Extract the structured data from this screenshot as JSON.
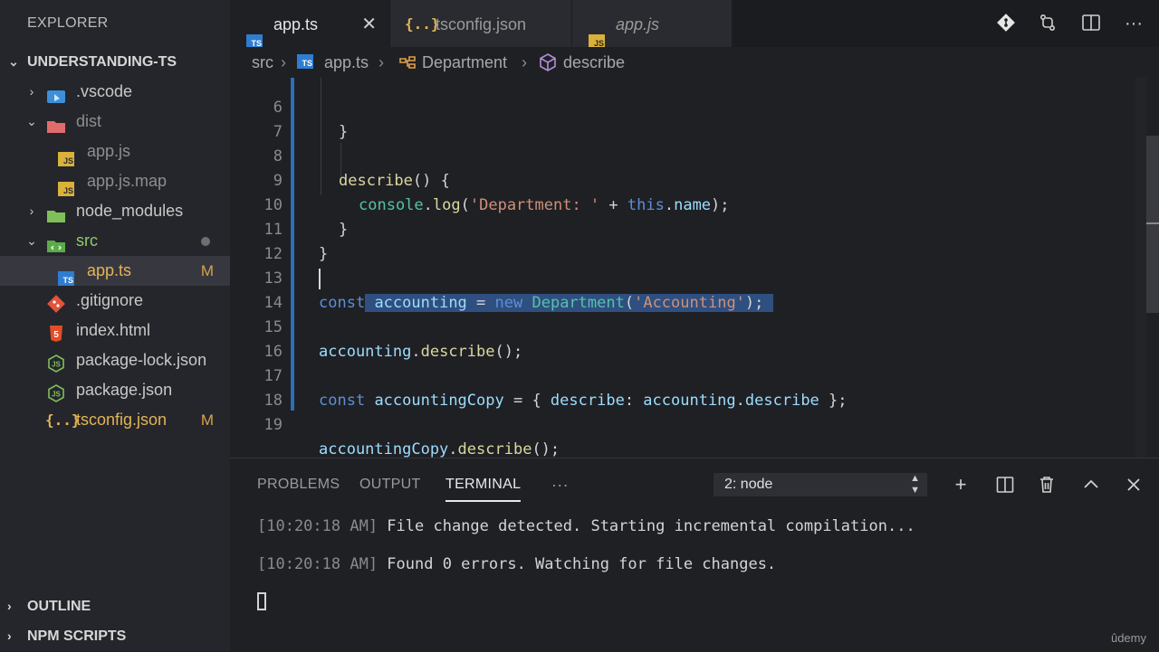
{
  "explorer": {
    "title": "EXPLORER",
    "root": "UNDERSTANDING-TS",
    "items": [
      {
        "label": ".vscode",
        "chevron": ">"
      },
      {
        "label": "dist",
        "chevron": "v"
      },
      {
        "label": "app.js"
      },
      {
        "label": "app.js.map"
      },
      {
        "label": "node_modules",
        "chevron": ">"
      },
      {
        "label": "src",
        "chevron": "v"
      },
      {
        "label": "app.ts",
        "badge": "M"
      },
      {
        "label": ".gitignore"
      },
      {
        "label": "index.html"
      },
      {
        "label": "package-lock.json"
      },
      {
        "label": "package.json"
      },
      {
        "label": "tsconfig.json",
        "badge": "M"
      }
    ],
    "sections": [
      {
        "label": "OUTLINE"
      },
      {
        "label": "NPM SCRIPTS"
      }
    ]
  },
  "tabs": [
    {
      "label": "app.ts",
      "icon": "TS",
      "active": true
    },
    {
      "label": "tsconfig.json",
      "icon": "{..}"
    },
    {
      "label": "app.js",
      "icon": "JS",
      "preview": true
    }
  ],
  "breadcrumb": {
    "parts": [
      "src",
      "app.ts",
      "Department",
      "describe"
    ]
  },
  "editor": {
    "lines": [
      {
        "n": "6"
      },
      {
        "n": "7"
      },
      {
        "n": "8"
      },
      {
        "n": "9"
      },
      {
        "n": "10"
      },
      {
        "n": "11"
      },
      {
        "n": "12"
      },
      {
        "n": "13"
      },
      {
        "n": "14"
      },
      {
        "n": "15"
      },
      {
        "n": "16"
      },
      {
        "n": "17"
      },
      {
        "n": "18"
      },
      {
        "n": "19"
      }
    ],
    "code": {
      "l6": "}",
      "l8_fn": "describe",
      "l8_rest": "() {",
      "l9_obj": "console",
      "l9_dot": ".",
      "l9_fn": "log",
      "l9_open": "(",
      "l9_str": "'Department: '",
      "l9_plus": " + ",
      "l9_this": "this",
      "l9_dot2": ".",
      "l9_prop": "name",
      "l9_end": ");",
      "l10": "}",
      "l11": "}",
      "l13_kw": "const",
      "l13_sp": " ",
      "l13_var": "accounting",
      "l13_eq": " = ",
      "l13_new": "new",
      "l13_sp2": " ",
      "l13_cls": "Department",
      "l13_open": "(",
      "l13_str": "'Accounting'",
      "l13_end": ");",
      "l15_var": "accounting",
      "l15_dot": ".",
      "l15_fn": "describe",
      "l15_end": "();",
      "l17_kw": "const",
      "l17_sp": " ",
      "l17_var": "accountingCopy",
      "l17_eq": " = { ",
      "l17_key": "describe",
      "l17_colon": ": ",
      "l17_obj": "accounting",
      "l17_dot": ".",
      "l17_prop": "describe",
      "l17_end": " };",
      "l19_var": "accountingCopy",
      "l19_dot": ".",
      "l19_fn": "describe",
      "l19_end": "();"
    }
  },
  "panel": {
    "tabs": [
      "PROBLEMS",
      "OUTPUT",
      "TERMINAL"
    ],
    "more": "···",
    "terminal_select": "2: node",
    "lines": [
      {
        "time": "[10:20:18 AM]",
        "text": " File change detected. Starting incremental compilation..."
      },
      {
        "time": "[10:20:18 AM]",
        "text": " Found 0 errors. Watching for file changes."
      }
    ]
  },
  "watermark": "ûdemy",
  "colors": {
    "accent_blue": "#2d6fb3",
    "modified": "#e2b455",
    "keyword": "#5c8fd6",
    "class": "#55c2a8",
    "string": "#ce9178"
  }
}
